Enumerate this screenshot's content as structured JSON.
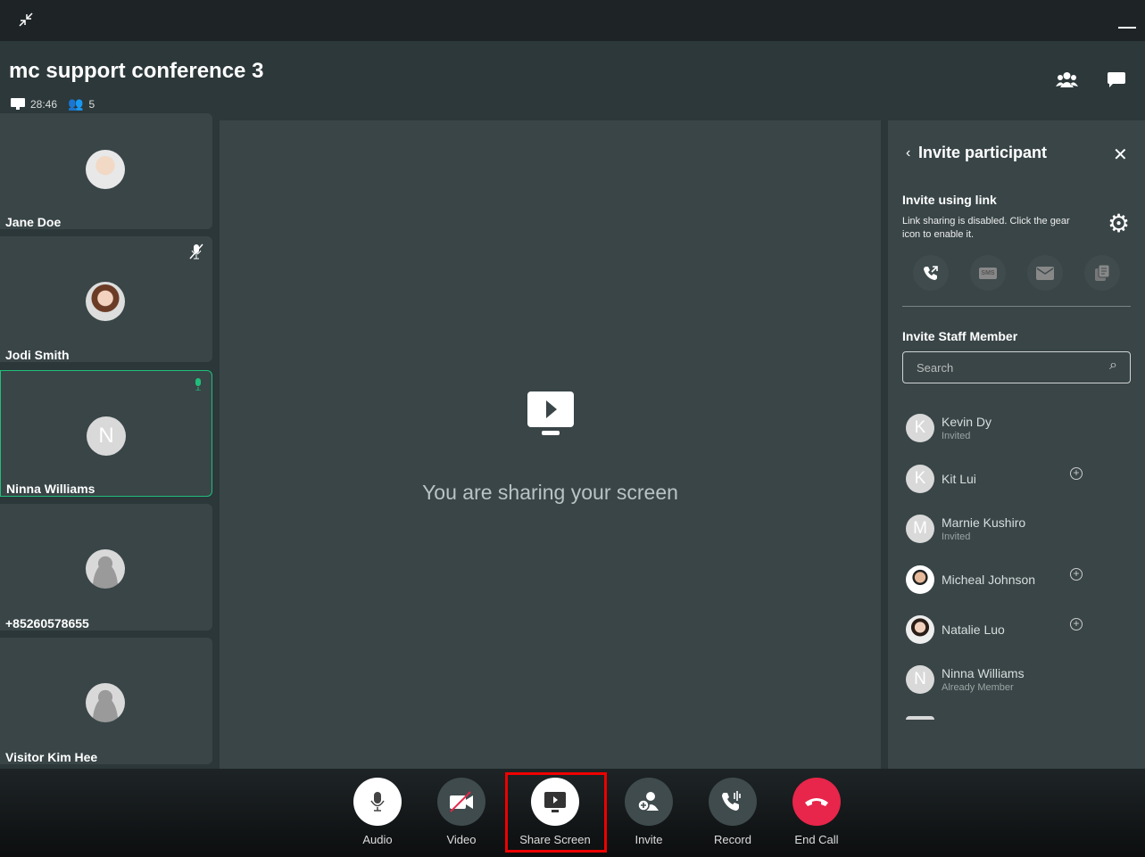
{
  "window": {
    "collapse_icon": "collapse-arrows-icon",
    "minimize_icon": "minimize-icon"
  },
  "header": {
    "title": "mc support conference 3",
    "duration": "28:46",
    "participant_count": "5",
    "participants_icon": "people-icon",
    "chat_icon": "chat-icon"
  },
  "tiles": [
    {
      "name": "Jane Doe",
      "avatar": "photo",
      "mic": "none"
    },
    {
      "name": "Jodi Smith",
      "avatar": "photo",
      "mic": "muted"
    },
    {
      "name": "Ninna Williams",
      "avatar": "N",
      "mic": "speaking",
      "active": true
    },
    {
      "name": "+85260578655",
      "avatar": "default",
      "mic": "none"
    },
    {
      "name": "Visitor Kim Hee",
      "avatar": "default",
      "mic": "none"
    }
  ],
  "main": {
    "message": "You are sharing your screen",
    "icon": "screen-share-icon"
  },
  "panel": {
    "title": "Invite participant",
    "link_heading": "Invite using link",
    "link_note": "Link sharing is disabled. Click the gear icon to enable it.",
    "staff_heading": "Invite Staff Member",
    "search_placeholder": "Search",
    "members": [
      {
        "name": "Kevin Dy",
        "status": "Invited",
        "initial": "K"
      },
      {
        "name": "Kit Lui",
        "status": "",
        "initial": "K",
        "addable": true
      },
      {
        "name": "Marnie Kushiro",
        "status": "Invited",
        "initial": "M"
      },
      {
        "name": "Micheal Johnson",
        "status": "",
        "initial": "photo",
        "addable": true
      },
      {
        "name": "Natalie Luo",
        "status": "",
        "initial": "photo",
        "addable": true
      },
      {
        "name": "Ninna Williams",
        "status": "Already Member",
        "initial": "N"
      }
    ]
  },
  "controls": [
    {
      "label": "Audio"
    },
    {
      "label": "Video"
    },
    {
      "label": "Share Screen",
      "highlighted": true
    },
    {
      "label": "Invite"
    },
    {
      "label": "Record"
    },
    {
      "label": "End Call",
      "color": "#e8254a"
    }
  ],
  "colors": {
    "accent_green": "#1fbf7a",
    "end_call": "#e8254a",
    "highlight": "#e00000"
  }
}
